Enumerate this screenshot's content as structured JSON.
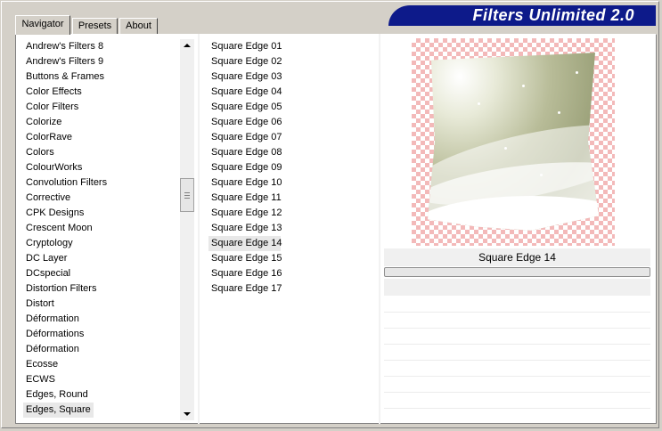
{
  "tabs": [
    {
      "label": "Navigator",
      "active": true
    },
    {
      "label": "Presets",
      "active": false
    },
    {
      "label": "About",
      "active": false
    }
  ],
  "brand": {
    "title": "Filters Unlimited 2.0",
    "color": "#0d1a8a"
  },
  "categories": [
    "Andrew's Filters 8",
    "Andrew's Filters 9",
    "Buttons & Frames",
    "Color Effects",
    "Color Filters",
    "Colorize",
    "ColorRave",
    "Colors",
    "ColourWorks",
    "Convolution Filters",
    "Corrective",
    "CPK Designs",
    "Crescent Moon",
    "Cryptology",
    "DC Layer",
    "DCspecial",
    "Distortion Filters",
    "Distort",
    "Déformation",
    "Déformations",
    "Déformation",
    "Ecosse",
    "ECWS",
    "Edges, Round",
    "Edges, Square"
  ],
  "selected_category": "Edges, Square",
  "filters": [
    "Square Edge 01",
    "Square Edge 02",
    "Square Edge 03",
    "Square Edge 04",
    "Square Edge 05",
    "Square Edge 06",
    "Square Edge 07",
    "Square Edge 08",
    "Square Edge 09",
    "Square Edge 10",
    "Square Edge 11",
    "Square Edge 12",
    "Square Edge 13",
    "Square Edge 14",
    "Square Edge 15",
    "Square Edge 16",
    "Square Edge 17"
  ],
  "selected_filter": "Square Edge 14",
  "preview": {
    "caption": "Square Edge 14"
  }
}
